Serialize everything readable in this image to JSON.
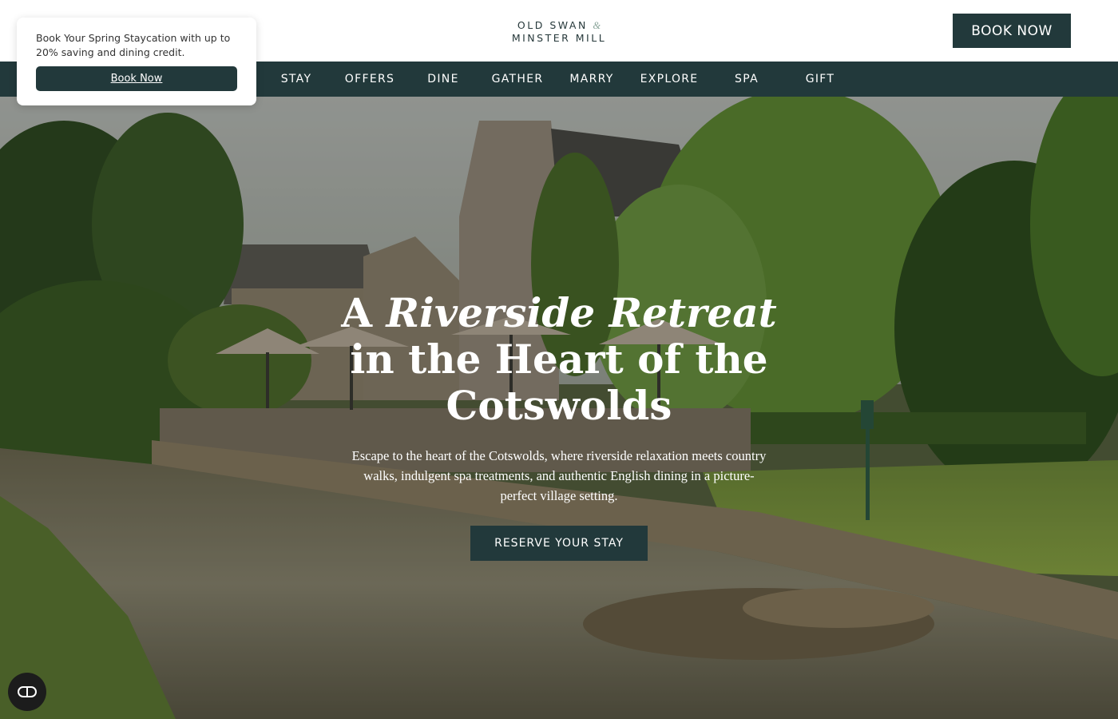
{
  "header": {
    "logo_line1": "OLD SWAN",
    "logo_amp": "&",
    "logo_line2": "MINSTER MILL",
    "book_now_label": "BOOK NOW"
  },
  "nav": {
    "items": [
      {
        "label": "STAY"
      },
      {
        "label": "OFFERS"
      },
      {
        "label": "DINE"
      },
      {
        "label": "GATHER"
      },
      {
        "label": "MARRY"
      },
      {
        "label": "EXPLORE"
      },
      {
        "label": "SPA"
      },
      {
        "label": "GIFT"
      }
    ]
  },
  "promo": {
    "text": "Book Your Spring Staycation with up to 20% saving and dining credit.",
    "button_label": "Book Now"
  },
  "hero": {
    "title_pre": "A ",
    "title_em": "Riverside Retreat",
    "title_post": " in the Heart of the Cotswolds",
    "subtitle": "Escape to the heart of the Cotswolds, where riverside relaxation meets country walks, indulgent spa treatments, and authentic English dining in a picture-perfect village setting.",
    "cta_label": "RESERVE YOUR STAY"
  },
  "accessibility": {
    "icon": "accessibility-toggle-icon"
  },
  "colors": {
    "brand_dark": "#22393b",
    "logo_accent": "#8aa59a",
    "white": "#ffffff"
  }
}
